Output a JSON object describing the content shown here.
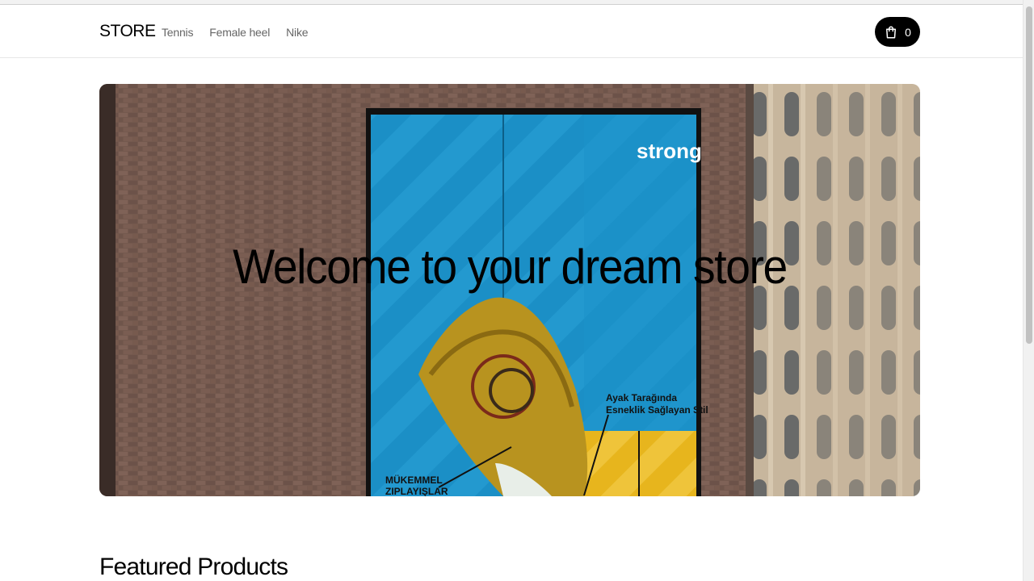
{
  "navbar": {
    "logo": "STORE",
    "links": [
      {
        "label": "Tennis"
      },
      {
        "label": "Female heel"
      },
      {
        "label": "Nike"
      }
    ],
    "cart_count": "0"
  },
  "hero": {
    "title": "Welcome to your dream store",
    "billboard_brand": "strong",
    "billboard_text_right_1": "Ayak Tarağında",
    "billboard_text_right_2": "Esneklik Sağlayan Stil",
    "billboard_text_left_1": "MÜKEMMEL",
    "billboard_text_left_2": "ZIPLAYIŞLAR"
  },
  "featured": {
    "title": "Featured Products"
  },
  "colors": {
    "cart_bg": "#000000",
    "nav_link": "#666666",
    "billboard_blue": "#1a8fc8",
    "billboard_yellow": "#e8b820",
    "brick": "#6b5048"
  }
}
